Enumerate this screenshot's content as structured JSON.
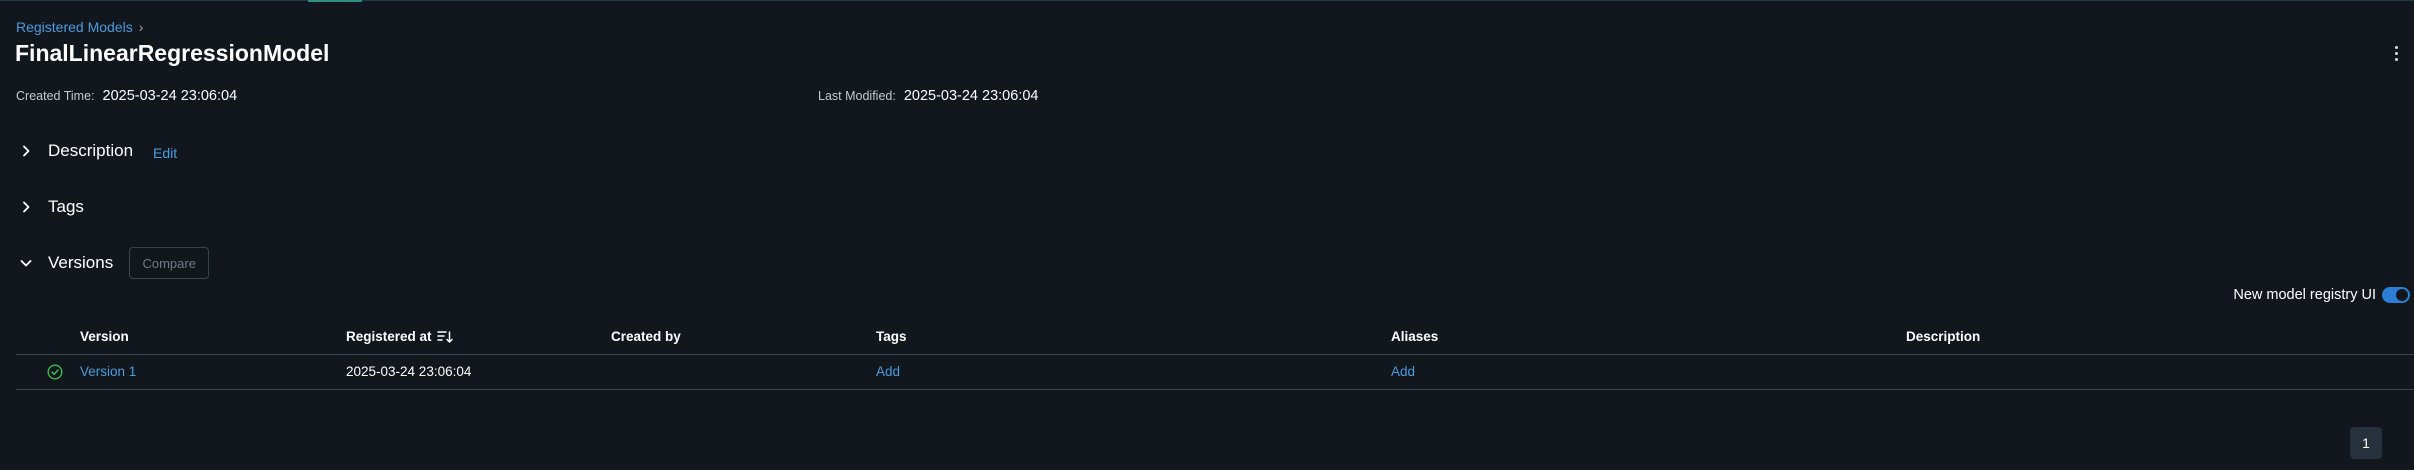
{
  "breadcrumb": {
    "parent": "Registered Models",
    "separator": "›"
  },
  "model": {
    "name": "FinalLinearRegressionModel",
    "created_label": "Created Time:",
    "created_value": "2025-03-24 23:06:04",
    "modified_label": "Last Modified:",
    "modified_value": "2025-03-24 23:06:04"
  },
  "sections": {
    "description": {
      "label": "Description",
      "edit": "Edit",
      "expanded": false
    },
    "tags": {
      "label": "Tags",
      "expanded": false
    },
    "versions": {
      "label": "Versions",
      "compare": "Compare",
      "expanded": true
    }
  },
  "toggle": {
    "label": "New model registry UI",
    "on": true
  },
  "table": {
    "columns": [
      "Version",
      "Registered at",
      "Created by",
      "Tags",
      "Aliases",
      "Description"
    ],
    "rows": [
      {
        "status": "ready",
        "version": "Version 1",
        "registered_at": "2025-03-24 23:06:04",
        "created_by": "",
        "tags": "Add",
        "aliases": "Add",
        "description": ""
      }
    ]
  },
  "pagination": {
    "current_page": "1"
  },
  "colors": {
    "background": "#11171d",
    "link": "#4a9ce0",
    "success": "#3fb950",
    "toggle_on": "#2a7fd4"
  }
}
